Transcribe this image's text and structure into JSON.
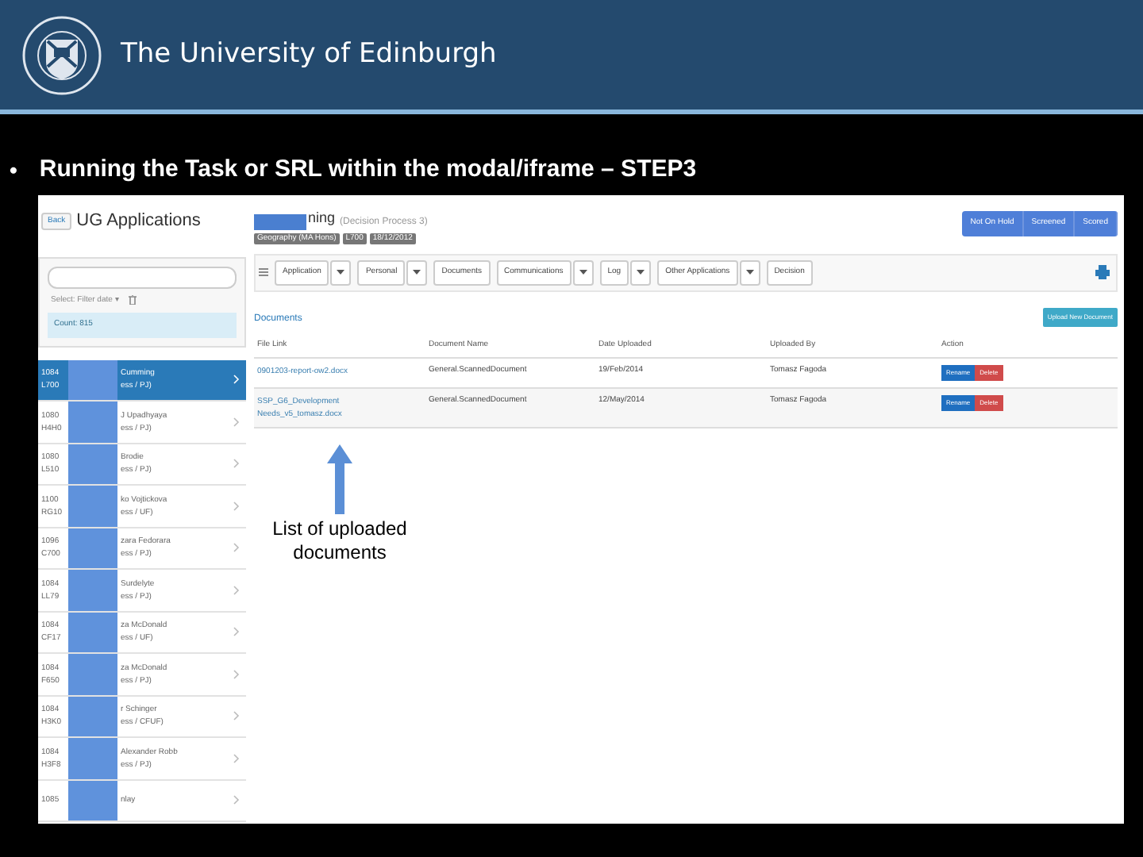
{
  "header": {
    "title": "The University of Edinburgh"
  },
  "slide": {
    "bullet": "•",
    "title": "Running the Task or SRL within the modal/iframe – STEP3"
  },
  "sidebar": {
    "back": "Back",
    "title": "UG Applications",
    "filter": "Select: Filter date ▾",
    "count": "Count: 815",
    "items": [
      {
        "id": "1084",
        "code": "L700",
        "name": "Cumming",
        "detail": "ess / PJ)",
        "selected": true
      },
      {
        "id": "1080",
        "code": "H4H0",
        "name": "J Upadhyaya",
        "detail": "ess / PJ)",
        "selected": false
      },
      {
        "id": "1080",
        "code": "L510",
        "name": "Brodie",
        "detail": "ess / PJ)",
        "selected": false
      },
      {
        "id": "1100",
        "code": "RG10",
        "name": "ko Vojtickova",
        "detail": "ess / UF)",
        "selected": false
      },
      {
        "id": "1096",
        "code": "C700",
        "name": "zara Fedorara",
        "detail": "ess / PJ)",
        "selected": false
      },
      {
        "id": "1084",
        "code": "LL79",
        "name": "Surdelyte",
        "detail": "ess / PJ)",
        "selected": false
      },
      {
        "id": "1084",
        "code": "CF17",
        "name": "za McDonald",
        "detail": "ess / UF)",
        "selected": false
      },
      {
        "id": "1084",
        "code": "F650",
        "name": "za McDonald",
        "detail": "ess / PJ)",
        "selected": false
      },
      {
        "id": "1084",
        "code": "H3K0",
        "name": "r Schinger",
        "detail": "ess / CFUF)",
        "selected": false
      },
      {
        "id": "1084",
        "code": "H3F8",
        "name": "Alexander Robb",
        "detail": "ess / PJ)",
        "selected": false
      },
      {
        "id": "1085",
        "name": "nlay",
        "selected": false
      }
    ]
  },
  "applicant": {
    "name": "ning",
    "process": "(Decision Process   3)",
    "tags": [
      "Geography (MA Hons)",
      "L700",
      "18/12/2012"
    ],
    "status_buttons": [
      "Not On Hold",
      "Screened",
      "Scored"
    ]
  },
  "toolbar": [
    {
      "label": "Application",
      "dropdown": true
    },
    {
      "label": "Personal",
      "dropdown": true
    },
    {
      "label": "Documents",
      "dropdown": false
    },
    {
      "label": "Communications",
      "dropdown": true
    },
    {
      "label": "Log",
      "dropdown": true
    },
    {
      "label": "Other Applications",
      "dropdown": true
    },
    {
      "label": "Decision",
      "dropdown": false
    }
  ],
  "documents": {
    "heading": "Documents",
    "upload": "Upload New Document",
    "columns": [
      "File Link",
      "Document Name",
      "Date Uploaded",
      "Uploaded By",
      "Action"
    ],
    "rows": [
      {
        "file": "0901203-report-ow2.docx",
        "name": "General.ScannedDocument",
        "date": "19/Feb/2014",
        "by": "Tomasz Fagoda",
        "actions": [
          "Rename",
          "Delete"
        ]
      },
      {
        "file": "SSP_G6_Development Needs_v5_tomasz.docx",
        "name": "General.ScannedDocument",
        "date": "12/May/2014",
        "by": "Tomasz Fagoda",
        "actions": [
          "Rename",
          "Delete"
        ]
      }
    ]
  },
  "annotation": "List of uploaded documents"
}
